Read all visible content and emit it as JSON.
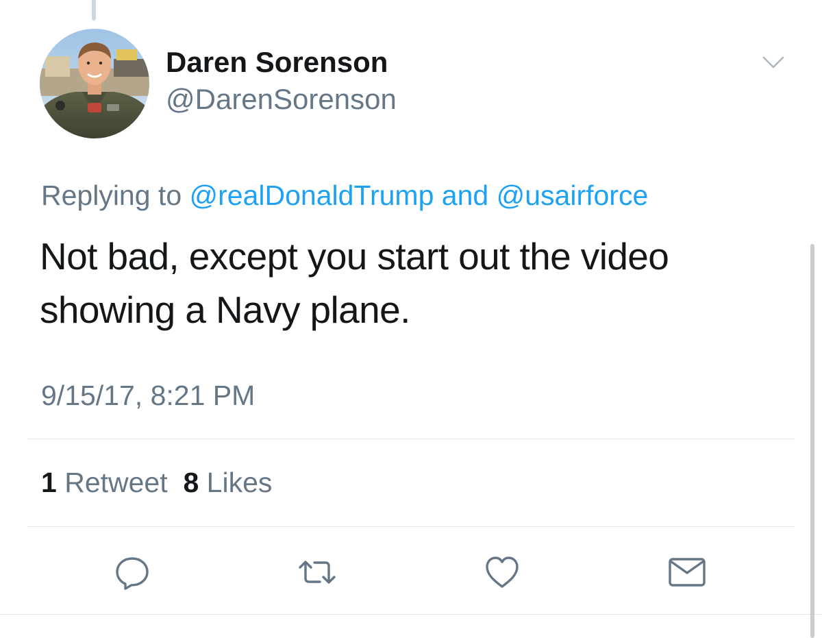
{
  "tweet": {
    "display_name": "Daren Sorenson",
    "handle": "@DarenSorenson",
    "reply": {
      "prefix": "Replying to",
      "mention_1": "@realDonaldTrump",
      "conjunction": "and",
      "mention_2": "@usairforce"
    },
    "text": "Not bad, except you start out the video showing a Navy plane.",
    "timestamp": "9/15/17, 8:21 PM",
    "stats": {
      "retweets_count": "1",
      "retweets_label": "Retweet",
      "likes_count": "8",
      "likes_label": "Likes"
    }
  },
  "actions": [
    {
      "icon": "reply-icon"
    },
    {
      "icon": "retweet-icon"
    },
    {
      "icon": "like-icon"
    },
    {
      "icon": "direct-message-icon"
    }
  ],
  "colors": {
    "primary_text": "#14171a",
    "secondary_text": "#657786",
    "link": "#1da1f2",
    "divider": "#e1e8ed"
  }
}
